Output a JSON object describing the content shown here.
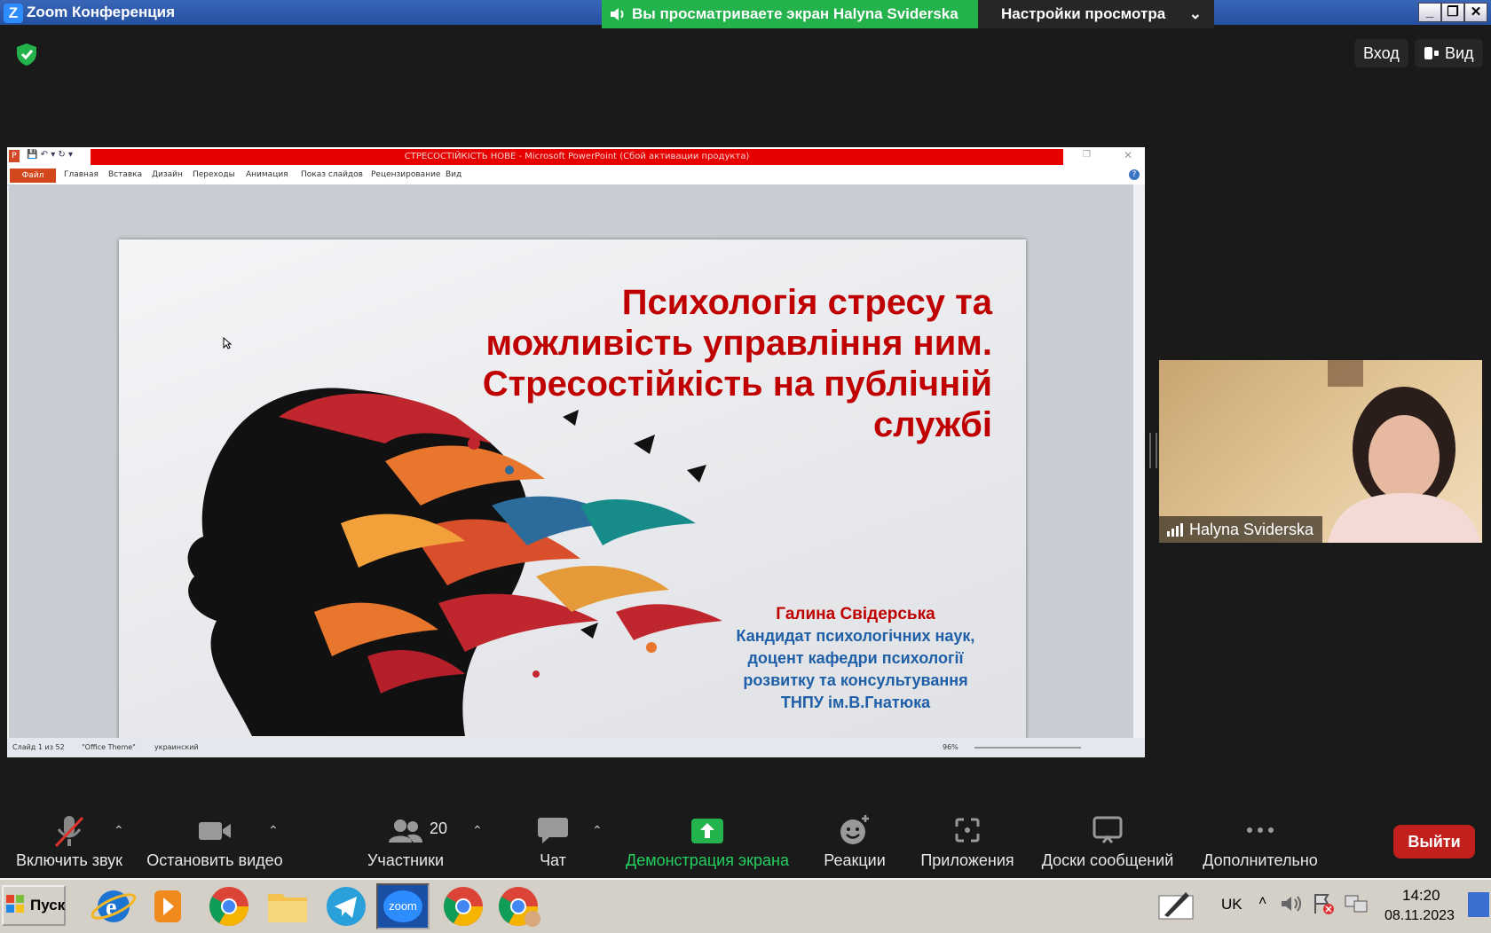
{
  "window": {
    "logo": "Z",
    "title": "Zoom Конференция",
    "controls": [
      "_",
      "❐",
      "✕"
    ]
  },
  "share_banner": {
    "text": "Вы просматриваете экран Halyna Sviderska",
    "view_settings": "Настройки просмотра",
    "accent": "#23b24b"
  },
  "topbar": {
    "signin": "Вход",
    "view": "Вид"
  },
  "ppt": {
    "title": "СТРЕСОСТІЙКІСТЬ НОВЕ  -  Microsoft PowerPoint (Сбой активации продукта)",
    "tabs": [
      "Файл",
      "Главная",
      "Вставка",
      "Дизайн",
      "Переходы",
      "Анимация",
      "Показ слайдов",
      "Рецензирование",
      "Вид"
    ],
    "status": {
      "slide": "Слайд 1 из 52",
      "theme": "\"Office Theme\"",
      "language": "украинский",
      "zoom": "96%"
    },
    "slide": {
      "title_lines": [
        "Психологія стресу та",
        "можливість управління ним.",
        "Стресостійкість на публічній",
        "службі"
      ],
      "author": "Галина Свідерська",
      "author_lines": [
        "Кандидат психологічних наук,",
        "доцент кафедри психології",
        "розвитку та консультування",
        "ТНПУ ім.В.Гнатюка"
      ]
    }
  },
  "video": {
    "participant_name": "Halyna Sviderska"
  },
  "toolbar": {
    "unmute": "Включить звук",
    "stop_video": "Остановить видео",
    "participants": "Участники",
    "participants_count": "20",
    "chat": "Чат",
    "share": "Демонстрация экрана",
    "reactions": "Реакции",
    "apps": "Приложения",
    "whiteboards": "Доски сообщений",
    "more": "Дополнительно",
    "leave": "Выйти",
    "share_color": "#23d160",
    "leave_color": "#c2201d"
  },
  "taskbar": {
    "start": "Пуск",
    "apps": [
      "internet-explorer-icon",
      "media-player-icon",
      "chrome-icon",
      "folder-icon",
      "telegram-icon",
      "zoom-icon",
      "chrome-icon",
      "chrome-profile-icon"
    ],
    "zoom_label": "zoom",
    "language": "UK",
    "time": "14:20",
    "date": "08.11.2023"
  }
}
